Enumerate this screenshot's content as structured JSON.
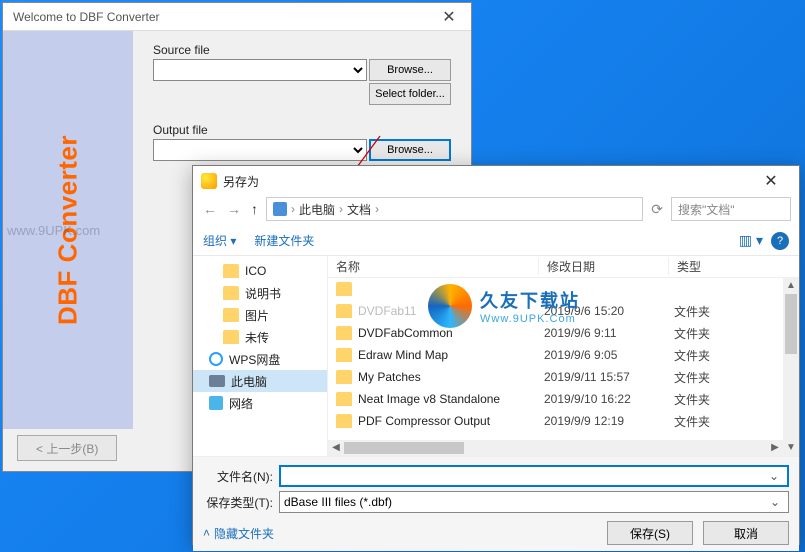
{
  "dbf": {
    "title": "Welcome to DBF Converter",
    "brand": "DBF Converter",
    "source_label": "Source file",
    "output_label": "Output file",
    "browse": "Browse...",
    "select_folder": "Select folder...",
    "back_btn": "< 上一步(B)",
    "watermark": "www.9UPK.com"
  },
  "save": {
    "title": "另存为",
    "nav": {
      "back": "←",
      "fwd": "→",
      "up": "↑"
    },
    "crumb": {
      "root": "此电脑",
      "folder": "文档"
    },
    "search_placeholder": "搜索\"文档\"",
    "toolbar": {
      "organize": "组织 ▾",
      "newfolder": "新建文件夹",
      "view": "▥ ▾",
      "help": "?"
    },
    "tree": [
      {
        "icon": "folder",
        "label": "ICO",
        "indent": 1
      },
      {
        "icon": "folder",
        "label": "说明书",
        "indent": 1
      },
      {
        "icon": "folder",
        "label": "图片",
        "indent": 1
      },
      {
        "icon": "folder",
        "label": "未传",
        "indent": 1
      },
      {
        "icon": "wps",
        "label": "WPS网盘",
        "indent": 0
      },
      {
        "icon": "pc",
        "label": "此电脑",
        "indent": 0,
        "selected": true
      },
      {
        "icon": "net",
        "label": "网络",
        "indent": 0
      }
    ],
    "columns": {
      "name": "名称",
      "date": "修改日期",
      "type": "类型"
    },
    "files": [
      {
        "name": "",
        "date": "",
        "type": "",
        "faded": true
      },
      {
        "name": "DVDFab11",
        "date": "2019/9/6 15:20",
        "type": "文件夹",
        "faded": true
      },
      {
        "name": "DVDFabCommon",
        "date": "2019/9/6 9:11",
        "type": "文件夹"
      },
      {
        "name": "Edraw Mind Map",
        "date": "2019/9/6 9:05",
        "type": "文件夹"
      },
      {
        "name": "My Patches",
        "date": "2019/9/11 15:57",
        "type": "文件夹"
      },
      {
        "name": "Neat Image v8 Standalone",
        "date": "2019/9/10 16:22",
        "type": "文件夹"
      },
      {
        "name": "PDF Compressor Output",
        "date": "2019/9/9 12:19",
        "type": "文件夹"
      }
    ],
    "filename_label": "文件名(N):",
    "filetype_label": "保存类型(T):",
    "filetype_value": "dBase III files (*.dbf)",
    "hide_folders": "隐藏文件夹",
    "save_btn": "保存(S)",
    "cancel_btn": "取消",
    "watermark": {
      "l1": "久友下载站",
      "l2": "Www.9UPK.Com"
    }
  }
}
